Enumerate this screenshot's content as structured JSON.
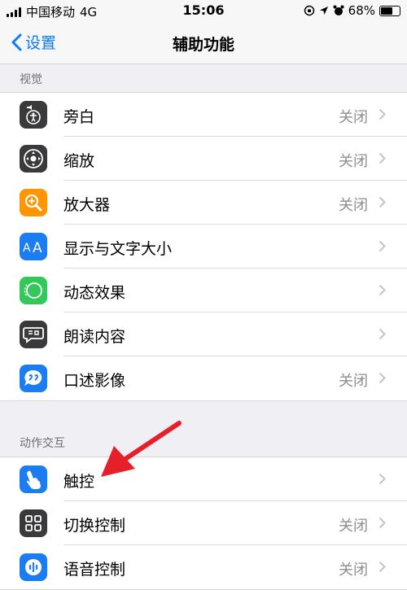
{
  "status": {
    "carrier": "中国移动",
    "network": "4G",
    "time": "15:06",
    "battery": "68%",
    "battery_level": 0.68
  },
  "nav": {
    "back_label": "设置",
    "title": "辅助功能"
  },
  "sections": [
    {
      "header": "视觉",
      "rows": [
        {
          "label": "旁白",
          "value": "关闭",
          "icon": "voiceover-icon",
          "color": "#3a3a3c"
        },
        {
          "label": "缩放",
          "value": "关闭",
          "icon": "zoom-icon",
          "color": "#3a3a3c"
        },
        {
          "label": "放大器",
          "value": "关闭",
          "icon": "magnifier-icon",
          "color": "#ff9500"
        },
        {
          "label": "显示与文字大小",
          "value": "",
          "icon": "text-size-icon",
          "color": "#1c7cf2"
        },
        {
          "label": "动态效果",
          "value": "",
          "icon": "motion-icon",
          "color": "#34c759"
        },
        {
          "label": "朗读内容",
          "value": "",
          "icon": "spoken-content-icon",
          "color": "#3a3a3c"
        },
        {
          "label": "口述影像",
          "value": "关闭",
          "icon": "audio-description-icon",
          "color": "#1c7cf2"
        }
      ]
    },
    {
      "header": "动作交互",
      "rows": [
        {
          "label": "触控",
          "value": "",
          "icon": "touch-icon",
          "color": "#1c7cf2"
        },
        {
          "label": "切换控制",
          "value": "关闭",
          "icon": "switch-control-icon",
          "color": "#3a3a3c"
        },
        {
          "label": "语音控制",
          "value": "关闭",
          "icon": "voice-control-icon",
          "color": "#1c7cf2"
        }
      ]
    }
  ],
  "annotation": {
    "color": "#e5202a"
  }
}
